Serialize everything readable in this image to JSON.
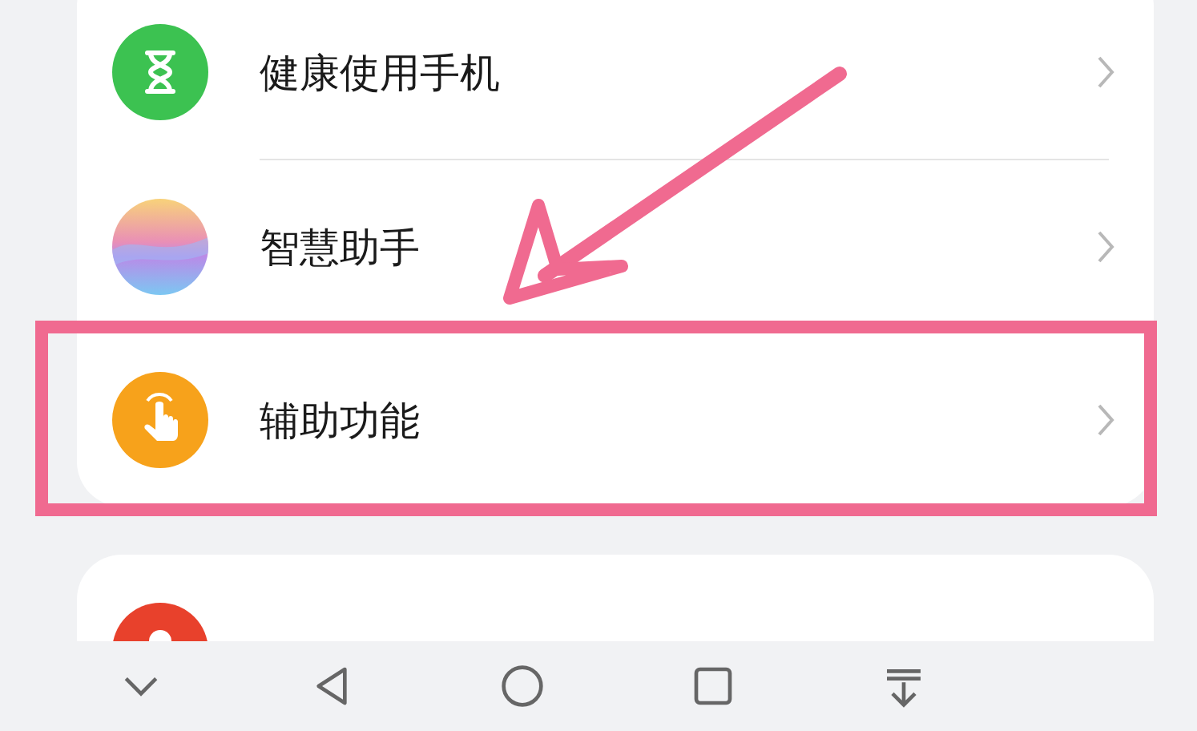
{
  "settings_group": {
    "items": [
      {
        "label": "健康使用手机",
        "kind": "hourglass",
        "highlighted": false
      },
      {
        "label": "智慧助手",
        "kind": "orb",
        "highlighted": false
      },
      {
        "label": "辅助功能",
        "kind": "hand",
        "highlighted": true
      }
    ]
  },
  "next_group": {
    "items": [
      {
        "kind": "person"
      }
    ]
  },
  "nav_bar": {
    "buttons": [
      {
        "kind": "hide"
      },
      {
        "kind": "back"
      },
      {
        "kind": "home"
      },
      {
        "kind": "recents"
      },
      {
        "kind": "pull_down"
      }
    ]
  }
}
